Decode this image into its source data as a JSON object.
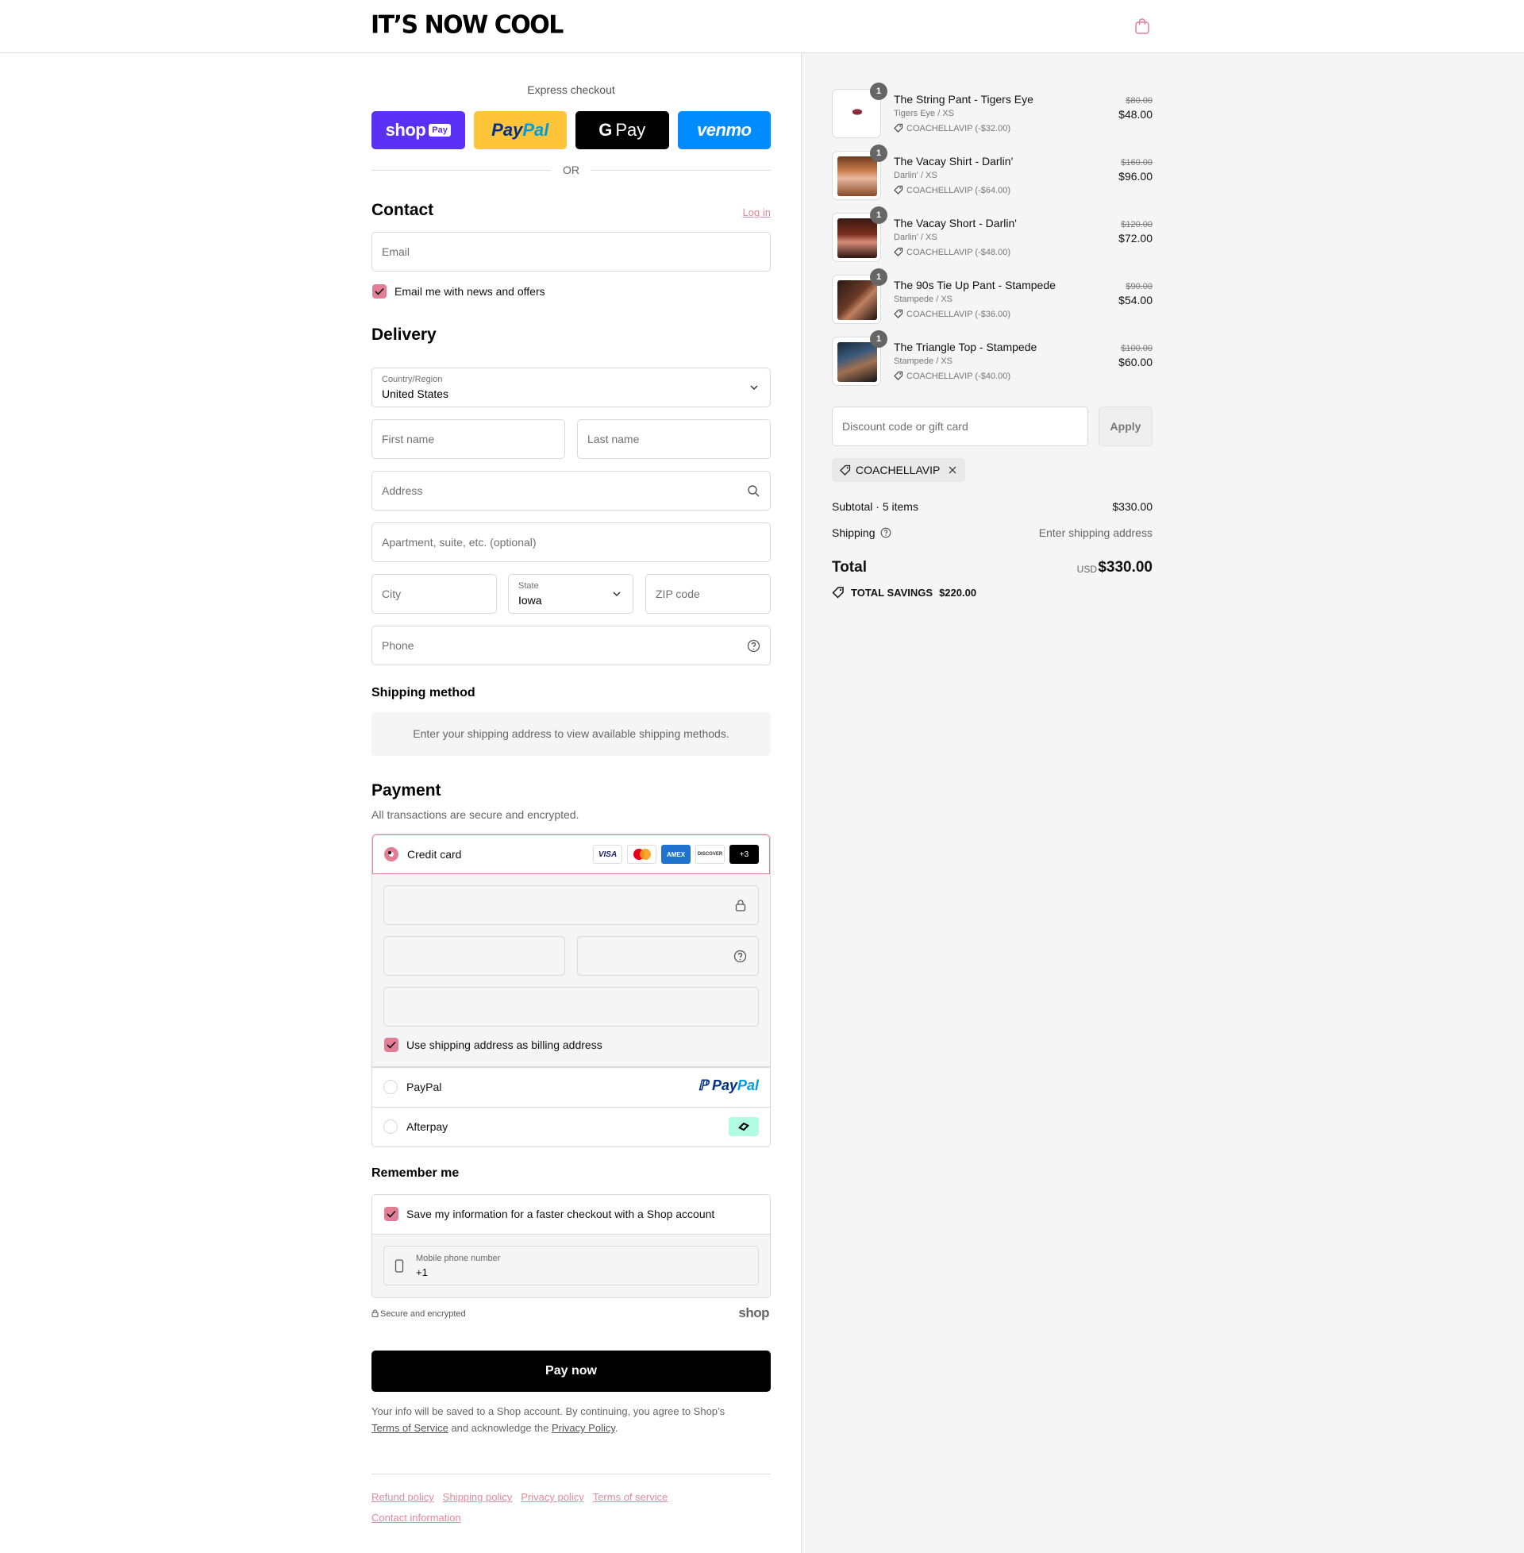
{
  "header": {
    "brand": "IT’S NOW COOL"
  },
  "express": {
    "title": "Express checkout",
    "shop_pay": "shop",
    "shop_pay_pill": "Pay",
    "paypal_a": "Pay",
    "paypal_b": "Pal",
    "gpay_g": "G",
    "gpay_text": "Pay",
    "venmo": "venmo",
    "or": "OR"
  },
  "contact": {
    "title": "Contact",
    "login": "Log in",
    "email_placeholder": "Email",
    "news_label": "Email me with news and offers"
  },
  "delivery": {
    "title": "Delivery",
    "country_label": "Country/Region",
    "country_value": "United States",
    "first_name": "First name",
    "last_name": "Last name",
    "address": "Address",
    "apartment": "Apartment, suite, etc. (optional)",
    "city": "City",
    "state_label": "State",
    "state_value": "Iowa",
    "zip": "ZIP code",
    "phone": "Phone"
  },
  "shipping_method": {
    "title": "Shipping method",
    "message": "Enter your shipping address to view available shipping methods."
  },
  "payment": {
    "title": "Payment",
    "subtitle": "All transactions are secure and encrypted.",
    "credit_card": "Credit card",
    "card_logos": {
      "visa": "VISA",
      "amex": "AMEX",
      "discover": "DISCOVER",
      "more": "+3"
    },
    "billing_label": "Use shipping address as billing address",
    "paypal": "PayPal",
    "paypal_logo_a": "Pay",
    "paypal_logo_b": "Pal",
    "afterpay": "Afterpay"
  },
  "remember": {
    "title": "Remember me",
    "save_label": "Save my information for a faster checkout with a Shop account",
    "mobile_label": "Mobile phone number",
    "mobile_value": "+1",
    "secure": "Secure and encrypted",
    "shop_mark": "shop"
  },
  "pay_now": "Pay now",
  "legal": {
    "text1": "Your info will be saved to a Shop account. By continuing, you agree to Shop’s",
    "tos": "Terms of Service",
    "text2": "and acknowledge the",
    "privacy": "Privacy Policy",
    "text3": "."
  },
  "footer_links": [
    "Refund policy",
    "Shipping policy",
    "Privacy policy",
    "Terms of service",
    "Contact information"
  ],
  "order": {
    "items": [
      {
        "qty": "1",
        "name": "The String Pant - Tigers Eye",
        "variant": "Tigers Eye / XS",
        "discount": "COACHELLAVIP (-$32.00)",
        "old_price": "$80.00",
        "price": "$48.00"
      },
      {
        "qty": "1",
        "name": "The Vacay Shirt - Darlin'",
        "variant": "Darlin' / XS",
        "discount": "COACHELLAVIP (-$64.00)",
        "old_price": "$160.00",
        "price": "$96.00"
      },
      {
        "qty": "1",
        "name": "The Vacay Short - Darlin'",
        "variant": "Darlin' / XS",
        "discount": "COACHELLAVIP (-$48.00)",
        "old_price": "$120.00",
        "price": "$72.00"
      },
      {
        "qty": "1",
        "name": "The 90s Tie Up Pant - Stampede",
        "variant": "Stampede / XS",
        "discount": "COACHELLAVIP (-$36.00)",
        "old_price": "$90.00",
        "price": "$54.00"
      },
      {
        "qty": "1",
        "name": "The Triangle Top - Stampede",
        "variant": "Stampede / XS",
        "discount": "COACHELLAVIP (-$40.00)",
        "old_price": "$100.00",
        "price": "$60.00"
      }
    ],
    "discount_placeholder": "Discount code or gift card",
    "apply": "Apply",
    "applied_code": "COACHELLAVIP",
    "subtotal_label": "Subtotal · 5 items",
    "subtotal_value": "$330.00",
    "shipping_label": "Shipping",
    "shipping_value": "Enter shipping address",
    "total_label": "Total",
    "currency": "USD",
    "total_value": "$330.00",
    "savings_label": "TOTAL SAVINGS",
    "savings_value": "$220.00"
  },
  "colors": {
    "accent": "#e27e96",
    "link": "#e3889d",
    "shop_purple": "#5a31f4",
    "venmo_blue": "#008cff",
    "paypal_yellow": "#ffc439"
  }
}
